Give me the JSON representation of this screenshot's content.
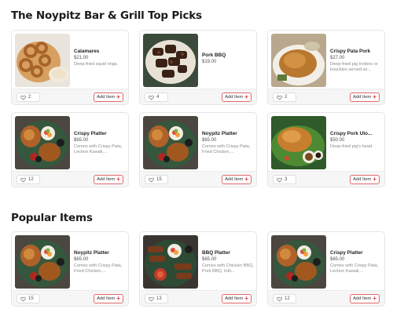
{
  "sections": {
    "top_picks_title": "The Noypitz Bar & Grill Top Picks",
    "popular_title": "Popular Items"
  },
  "add_label": "Add Item",
  "cards": {
    "c1": {
      "name": "Calamares",
      "price": "$21.00",
      "desc": "Deep-fried squid rings.",
      "likes": "2",
      "image": "calamares-photo"
    },
    "c2": {
      "name": "Pork BBQ",
      "price": "$19.00",
      "desc": "",
      "likes": "4",
      "image": "pork-bbq-photo"
    },
    "c3": {
      "name": "Crispy Pata Pork",
      "price": "$27.00",
      "desc": "Deep-fried pig trotters or knuckles served wi...",
      "likes": "2",
      "image": "crispy-pata-photo"
    },
    "c4": {
      "name": "Crispy Platter",
      "price": "$65.00",
      "desc": "Comes with Crispy Pata, Lechon Kawali,...",
      "likes": "12",
      "image": "platter-photo"
    },
    "c5": {
      "name": "Noypitz Platter",
      "price": "$65.00",
      "desc": "Comes with Crispy Pata, Fried Chicken,...",
      "likes": "15",
      "image": "platter-photo"
    },
    "c6": {
      "name": "Crispy Pork Ulo...",
      "price": "$50.00",
      "desc": "Deep-fried pig's head.",
      "likes": "3",
      "image": "pork-ulo-photo"
    },
    "c7": {
      "name": "Noypitz Platter",
      "price": "$65.00",
      "desc": "Comes with Crispy Pata, Fried Chicken,...",
      "likes": "15",
      "image": "platter-photo"
    },
    "c8": {
      "name": "BBQ Platter",
      "price": "$65.00",
      "desc": "Comes with Chicken BBQ, Pork BBQ, Inih...",
      "likes": "13",
      "image": "bbq-platter-photo"
    },
    "c9": {
      "name": "Crispy Platter",
      "price": "$65.00",
      "desc": "Comes with Crispy Pata, Lechon Kawali,...",
      "likes": "12",
      "image": "platter-photo"
    }
  },
  "colors": {
    "accent": "#e0393e",
    "border": "#e6e6e6",
    "footer_bg": "#f6f6f6"
  }
}
